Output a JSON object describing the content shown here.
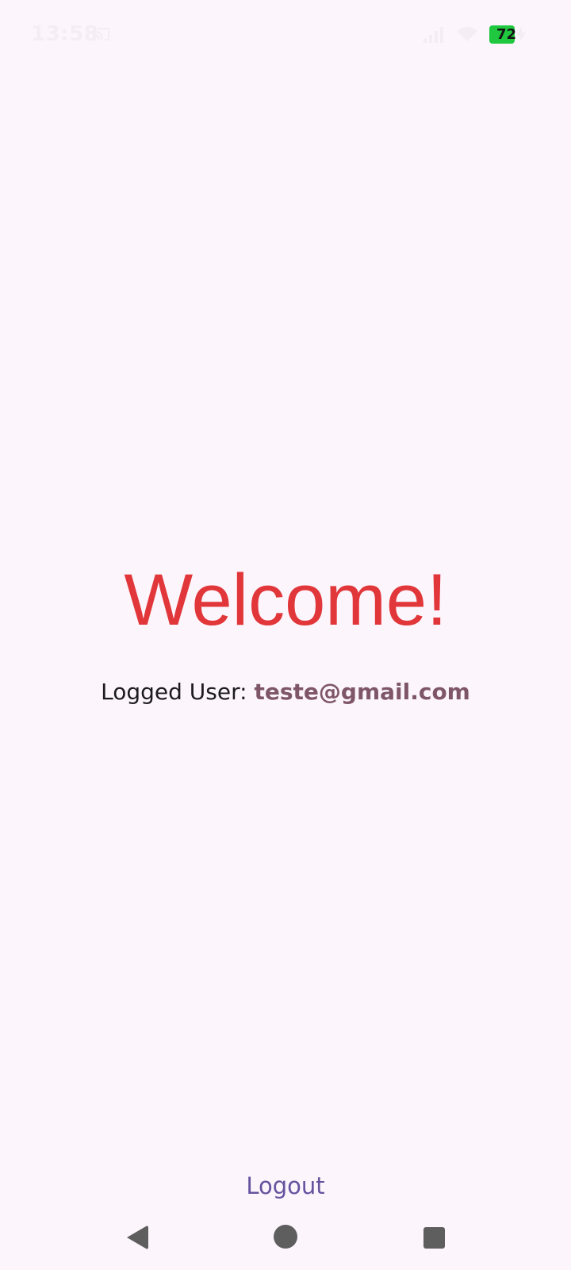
{
  "status_bar": {
    "time": "13:58",
    "battery_level": "72",
    "battery_color": "#1FC83F",
    "icons": [
      "cast-icon",
      "signal-icon",
      "wifi-icon",
      "battery-icon",
      "charging-icon"
    ]
  },
  "main": {
    "welcome_text": "Welcome!",
    "logged_user_label": "Logged User: ",
    "logged_user_email": "teste@gmail.com"
  },
  "actions": {
    "logout_label": "Logout"
  },
  "nav_bar": {
    "icons": [
      "back-icon",
      "home-icon",
      "recents-icon"
    ]
  },
  "colors": {
    "background": "#FCF5FC",
    "welcome": "#E1373A",
    "email": "#7E5667",
    "logout": "#65539E",
    "nav_icons": "#5E5E5E"
  }
}
